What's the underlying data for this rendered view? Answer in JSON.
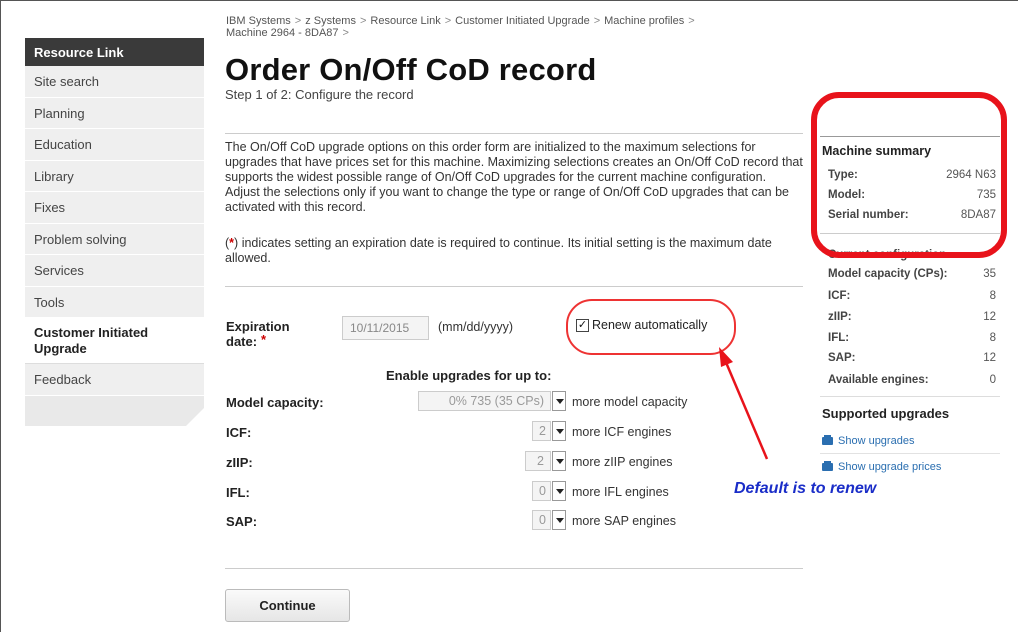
{
  "breadcrumb": {
    "items": [
      "IBM Systems",
      "z Systems",
      "Resource Link",
      "Customer Initiated Upgrade",
      "Machine profiles"
    ],
    "line2": "Machine 2964 - 8DA87",
    "separator": ">"
  },
  "sidebar": {
    "heading": "Resource Link",
    "items": [
      {
        "label": "Site search"
      },
      {
        "label": "Planning"
      },
      {
        "label": "Education"
      },
      {
        "label": "Library"
      },
      {
        "label": "Fixes"
      },
      {
        "label": "Problem solving"
      },
      {
        "label": "Services"
      },
      {
        "label": "Tools"
      },
      {
        "label": "Customer Initiated Upgrade",
        "active": true
      },
      {
        "label": "Feedback"
      }
    ]
  },
  "main": {
    "title": "Order On/Off CoD record",
    "subtitle": "Step 1 of 2: Configure the record",
    "intro": "The On/Off CoD upgrade options on this order form are initialized to the maximum selections for upgrades that have prices set for this machine. Maximizing selections creates an On/Off CoD record that supports the widest possible range of On/Off CoD upgrades for the current machine configuration. Adjust the selections only if you want to change the type or range of On/Off CoD upgrades that can be activated with this record.",
    "note_marker": "*",
    "note_text": "indicates setting an expiration date is required to continue. Its initial setting is the maximum date allowed.",
    "expiration": {
      "label": "Expiration date:",
      "required_marker": "*",
      "value": "10/11/2015",
      "format": "(mm/dd/yyyy)"
    },
    "renew": {
      "label": "Renew automatically",
      "checked": true
    },
    "upgrades_heading": "Enable upgrades for up to:",
    "upgrades": [
      {
        "label": "Model capacity:",
        "value": "0% 735 (35 CPs)",
        "suffix": "more model capacity"
      },
      {
        "label": "ICF:",
        "value": "2",
        "suffix": "more ICF engines"
      },
      {
        "label": "zIIP:",
        "value": "2",
        "suffix": "more zIIP engines"
      },
      {
        "label": "IFL:",
        "value": "0",
        "suffix": "more IFL engines"
      },
      {
        "label": "SAP:",
        "value": "0",
        "suffix": "more SAP engines"
      }
    ],
    "continue_label": "Continue"
  },
  "right_panel": {
    "summary_title": "Machine summary",
    "summary": [
      {
        "key": "Type:",
        "value": "2964 N63"
      },
      {
        "key": "Model:",
        "value": "735"
      },
      {
        "key": "Serial number:",
        "value": "8DA87"
      }
    ],
    "config_title": "Current configuration",
    "config": [
      {
        "key": "Model capacity (CPs):",
        "value": "35"
      },
      {
        "key": "ICF:",
        "value": "8"
      },
      {
        "key": "zIIP:",
        "value": "12"
      },
      {
        "key": "IFL:",
        "value": "8"
      },
      {
        "key": "SAP:",
        "value": "12"
      },
      {
        "key": "Available engines:",
        "value": "0"
      }
    ],
    "supported_title": "Supported upgrades",
    "links": [
      "Show upgrades",
      "Show upgrade prices"
    ]
  },
  "annotation": {
    "text": "Default is to renew",
    "color": "#1a2dc8",
    "highlight_color": "#e8131b"
  }
}
